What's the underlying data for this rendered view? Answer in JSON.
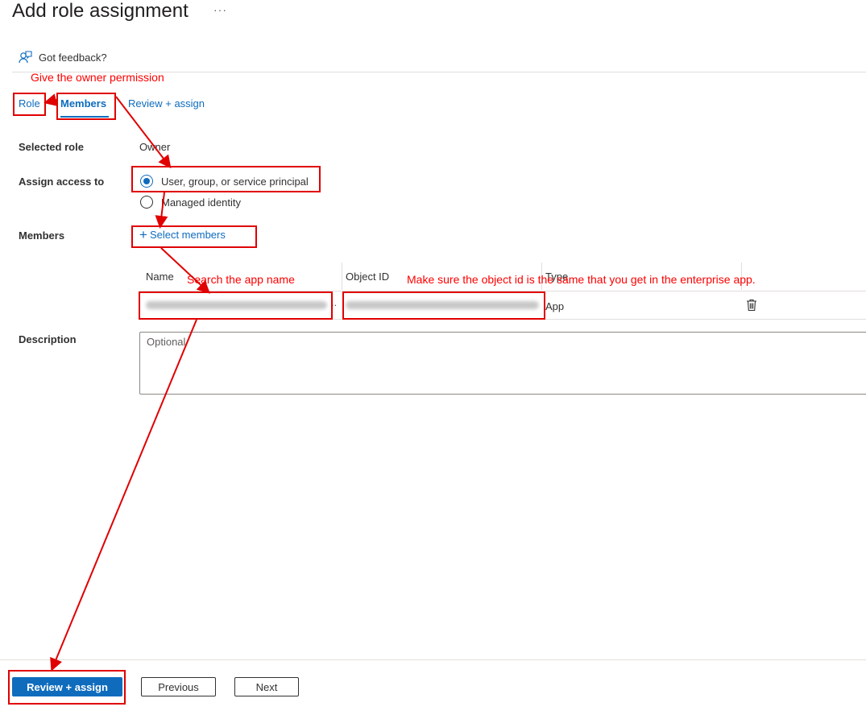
{
  "header": {
    "title": "Add role assignment",
    "more_label": "···",
    "feedback_label": "Got feedback?"
  },
  "tabs": [
    {
      "label": "Role",
      "active": false
    },
    {
      "label": "Members",
      "active": true
    },
    {
      "label": "Review + assign",
      "active": false
    }
  ],
  "form": {
    "selected_role_label": "Selected role",
    "selected_role_value": "Owner",
    "assign_access_label": "Assign access to",
    "assign_options": [
      {
        "label": "User, group, or service principal",
        "checked": true
      },
      {
        "label": "Managed identity",
        "checked": false
      }
    ],
    "members_label": "Members",
    "select_members_label": "Select members",
    "description_label": "Description",
    "description_placeholder": "Optional"
  },
  "members_table": {
    "columns": [
      "Name",
      "Object ID",
      "Type"
    ],
    "rows": [
      {
        "name": "[blurred app name]",
        "object_id": "[blurred object id]",
        "type": "App"
      }
    ]
  },
  "footer": {
    "review_assign_label": "Review + assign",
    "previous_label": "Previous",
    "next_label": "Next"
  },
  "annotations": {
    "owner_note": "Give the owner permission",
    "search_note": "Search the app name",
    "object_id_note": "Make sure the object id is the same that you get in the enterprise app.",
    "color": "#ff0000"
  }
}
